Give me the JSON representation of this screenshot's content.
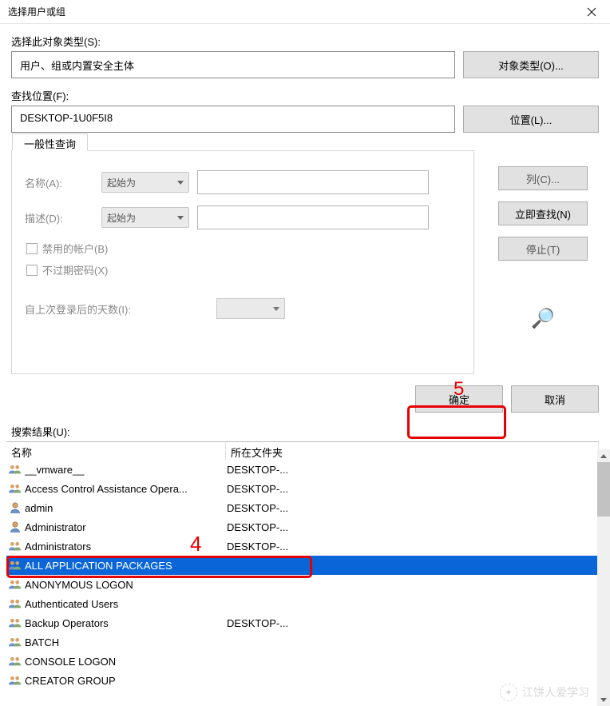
{
  "window": {
    "title": "选择用户或组"
  },
  "objectType": {
    "label": "选择此对象类型(S):",
    "value": "用户、组或内置安全主体",
    "button": "对象类型(O)..."
  },
  "location": {
    "label": "查找位置(F):",
    "value": "DESKTOP-1U0F5I8",
    "button": "位置(L)..."
  },
  "queryTab": {
    "label": "一般性查询",
    "nameLabel": "名称(A):",
    "descLabel": "描述(D):",
    "comboText": "起始为",
    "chkDisabled": "禁用的帐户(B)",
    "chkNoExpire": "不过期密码(X)",
    "daysLabel": "自上次登录后的天数(I):"
  },
  "sideButtons": {
    "columns": "列(C)...",
    "findNow": "立即查找(N)",
    "stop": "停止(T)"
  },
  "footer": {
    "ok": "确定",
    "cancel": "取消"
  },
  "annotations": {
    "four": "4",
    "five": "5"
  },
  "results": {
    "label": "搜索结果(U):",
    "headers": {
      "name": "名称",
      "folder": "所在文件夹"
    },
    "rows": [
      {
        "icon": "group",
        "name": "__vmware__",
        "folder": "DESKTOP-...",
        "selected": false
      },
      {
        "icon": "group",
        "name": "Access Control Assistance Opera...",
        "folder": "DESKTOP-...",
        "selected": false
      },
      {
        "icon": "user",
        "name": "admin",
        "folder": "DESKTOP-...",
        "selected": false
      },
      {
        "icon": "user",
        "name": "Administrator",
        "folder": "DESKTOP-...",
        "selected": false
      },
      {
        "icon": "group",
        "name": "Administrators",
        "folder": "DESKTOP-...",
        "selected": false
      },
      {
        "icon": "group",
        "name": "ALL APPLICATION PACKAGES",
        "folder": "",
        "selected": true
      },
      {
        "icon": "group",
        "name": "ANONYMOUS LOGON",
        "folder": "",
        "selected": false
      },
      {
        "icon": "group",
        "name": "Authenticated Users",
        "folder": "",
        "selected": false
      },
      {
        "icon": "group",
        "name": "Backup Operators",
        "folder": "DESKTOP-...",
        "selected": false
      },
      {
        "icon": "group",
        "name": "BATCH",
        "folder": "",
        "selected": false
      },
      {
        "icon": "group",
        "name": "CONSOLE LOGON",
        "folder": "",
        "selected": false
      },
      {
        "icon": "group",
        "name": "CREATOR GROUP",
        "folder": "",
        "selected": false
      }
    ]
  },
  "watermark": {
    "text": "江饼人爱学习"
  }
}
